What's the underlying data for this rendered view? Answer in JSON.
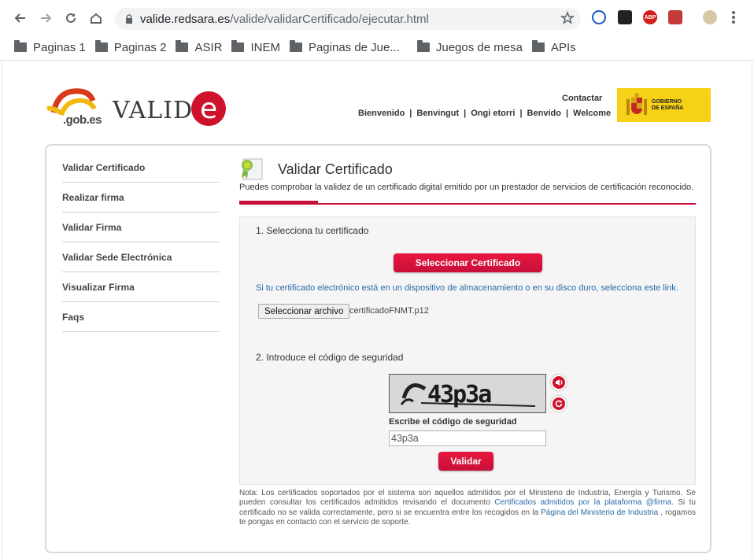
{
  "browser": {
    "url_host": "valide.redsara.es",
    "url_path": "/valide/validarCertificado/ejecutar.html",
    "bookmarks": [
      "Paginas 1",
      "Paginas 2",
      "ASIR",
      "INEM",
      "Paginas de Jue...",
      "Juegos de mesa",
      "APIs"
    ],
    "extensions": [
      "ABP"
    ]
  },
  "header": {
    "gob_logo": ".gob.es",
    "valide_logo": "VALID",
    "valide_e": "e",
    "contact": "Contactar",
    "languages": [
      "Bienvenido",
      "Benvingut",
      "Ongi etorri",
      "Benvido",
      "Welcome"
    ],
    "gobierno": [
      "GOBIERNO",
      "DE ESPAÑA"
    ]
  },
  "sidebar": {
    "items": [
      "Validar Certificado",
      "Realizar firma",
      "Validar Firma",
      "Validar Sede Electrónica",
      "Visualizar Firma",
      "Faqs"
    ]
  },
  "main": {
    "title": "Validar Certificado",
    "subtitle": "Puedes comprobar la validez de un certificado digital emitido por un prestador de servicios de certificación reconocido.",
    "step1": "1. Selecciona tu certificado",
    "select_cert_button": "Seleccionar Certificado",
    "link_info": "Si tu certificado electrónico está en un dispositivo de almacenamiento o en su disco duro, selecciona este link.",
    "file_button": "Seleccionar archivo",
    "file_name": "certificadoFNMT.p12",
    "step2": "2. Introduce el código de seguridad",
    "captcha_text": "43p3a",
    "code_label": "Escribe el código de seguridad",
    "code_value": "43p3a",
    "validate_button": "Validar",
    "note_part1": "Nota: Los certificados soportados por el sistema son aquellos admitidos por el Ministerio de Industria, Energía y Turismo. Se pueden consultar los certificados admitidos revisando el documento ",
    "note_link1": "Certificados admitidos por la plataforma @firma.",
    "note_part2": " Si tu certificado no se valida correctamente, pero si se encuentra entre los recogidos en la ",
    "note_link2": "Página del Ministerio de Industria",
    "note_part3": " , rogamos te pongas en contacto con el servicio de soporte."
  },
  "colors": {
    "accent": "#c80f3a",
    "link": "#2a6aa9",
    "gobierno_bg": "#f7d117"
  }
}
